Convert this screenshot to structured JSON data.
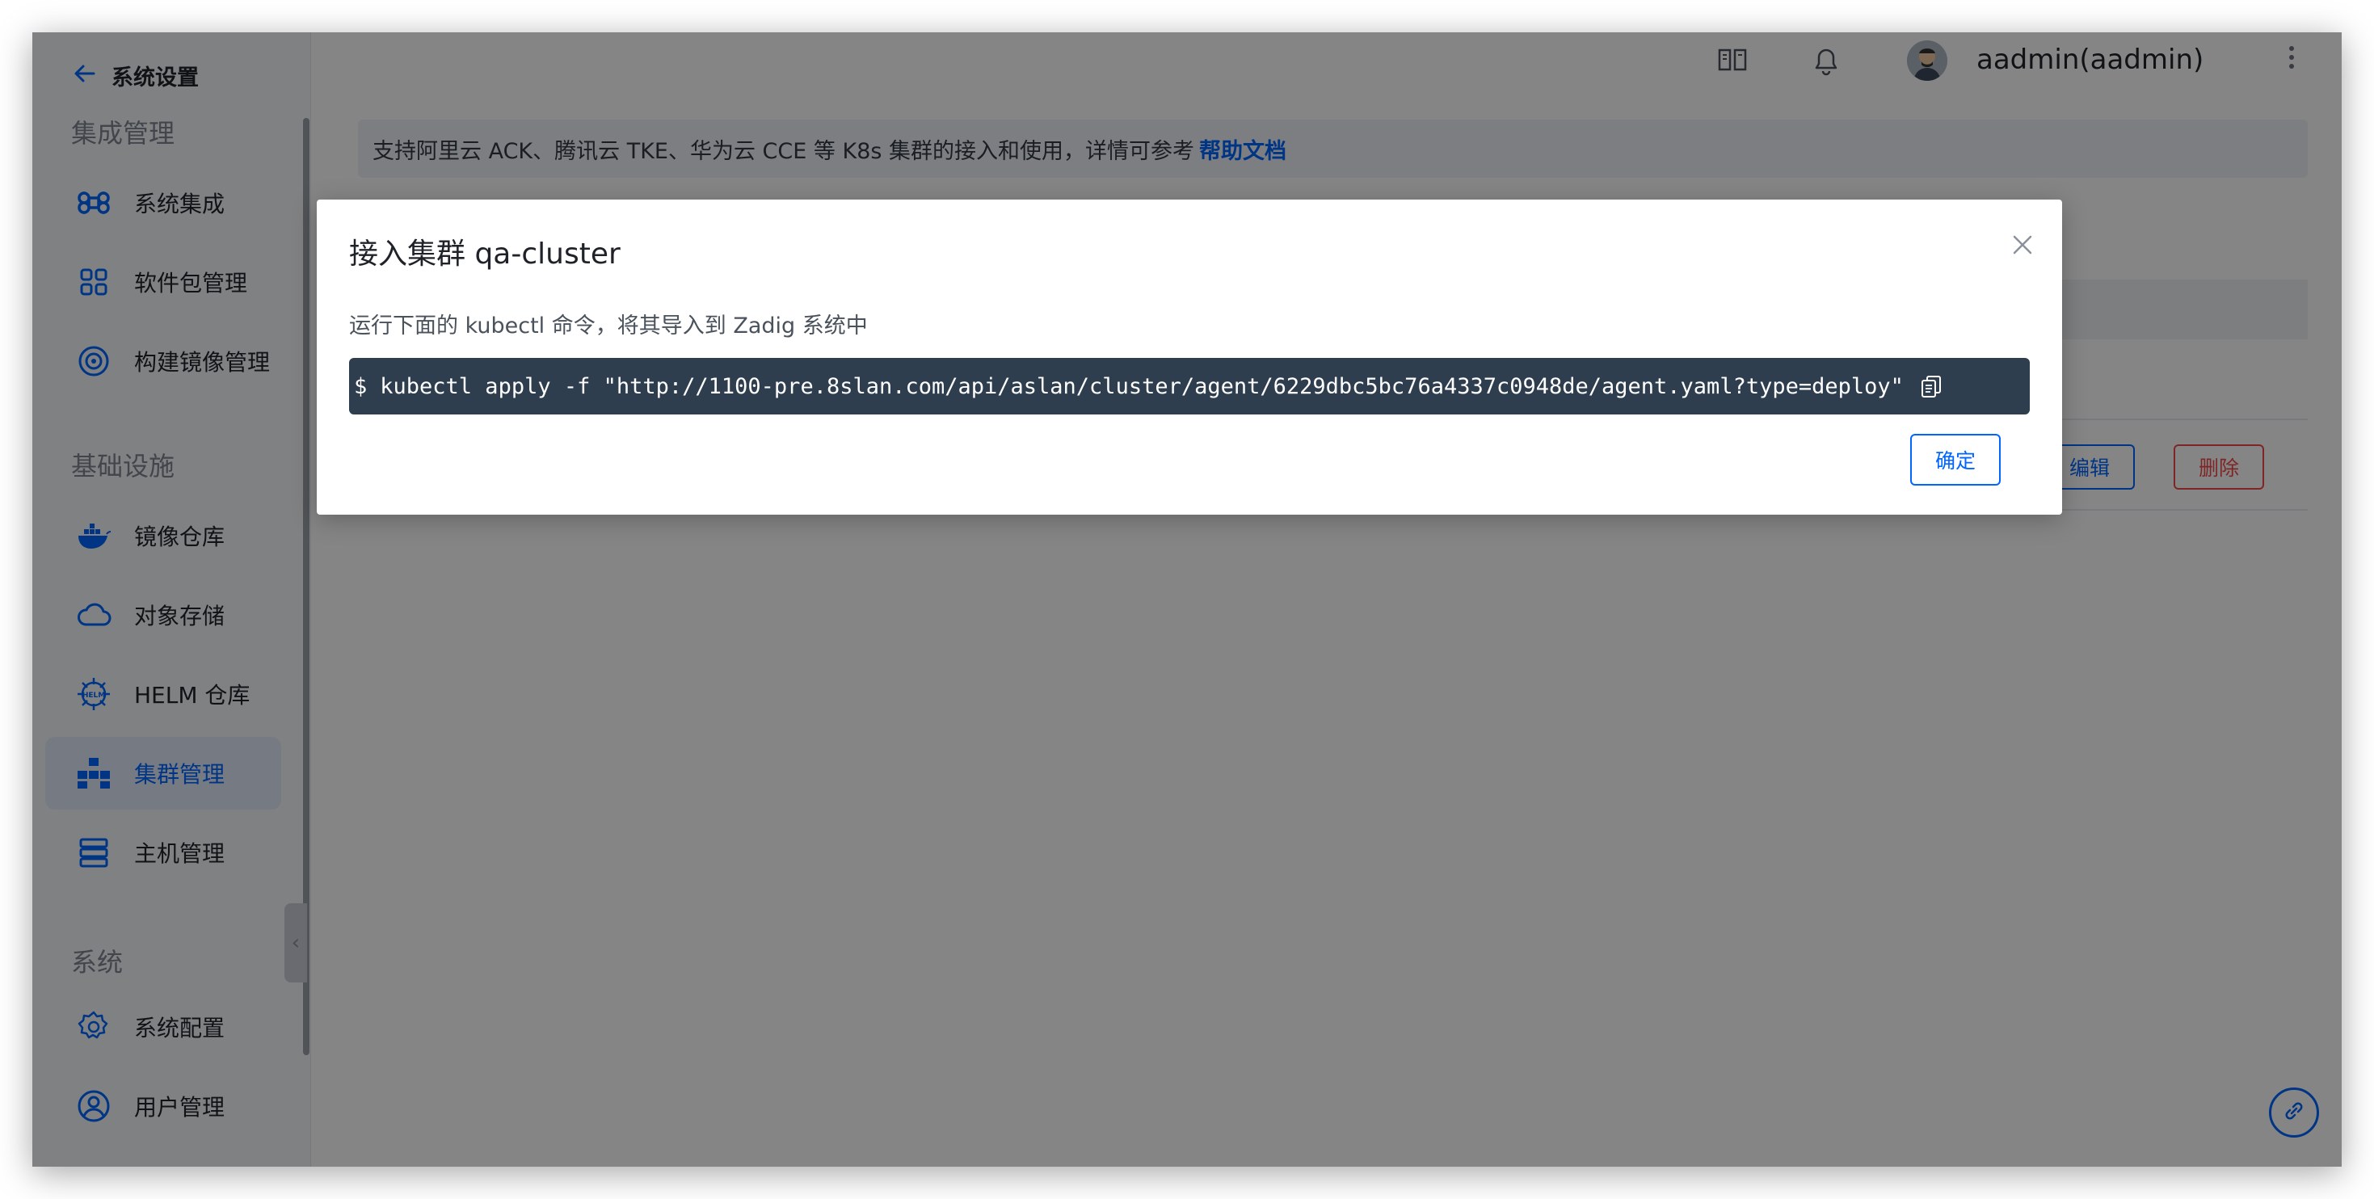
{
  "sidebar": {
    "back_title": "系统设置",
    "groups": [
      {
        "title": "集成管理"
      },
      {
        "title": "基础设施"
      },
      {
        "title": "系统"
      }
    ],
    "items": [
      {
        "label": "系统集成",
        "icon": "command-icon"
      },
      {
        "label": "软件包管理",
        "icon": "apps-icon"
      },
      {
        "label": "构建镜像管理",
        "icon": "disc-icon"
      },
      {
        "label": "镜像仓库",
        "icon": "docker-icon"
      },
      {
        "label": "对象存储",
        "icon": "cloud-icon"
      },
      {
        "label": "HELM 仓库",
        "icon": "helm-icon"
      },
      {
        "label": "集群管理",
        "icon": "cluster-icon"
      },
      {
        "label": "主机管理",
        "icon": "server-icon"
      },
      {
        "label": "系统配置",
        "icon": "settings-icon"
      },
      {
        "label": "用户管理",
        "icon": "user-icon"
      }
    ]
  },
  "topbar": {
    "user": "aadmin(aadmin)"
  },
  "main": {
    "banner_text": "支持阿里云 ACK、腾讯云 TKE、华为云 CCE 等 K8s 集群的接入和使用，详情可参考",
    "banner_link": "帮助文档",
    "edit_label": "编辑",
    "delete_label": "删除"
  },
  "modal": {
    "title": "接入集群 qa-cluster",
    "description": "运行下面的 kubectl 命令，将其导入到 Zadig 系统中",
    "prompt": "$",
    "command": "kubectl apply -f \"http://1100-pre.8slan.com/api/aslan/cluster/agent/6229dbc5bc76a4337c0948de/agent.yaml?type=deploy\"",
    "ok_label": "确定"
  },
  "colors": {
    "accent": "#0066ff",
    "danger": "#f24949",
    "command_bg": "#2f3e4e"
  }
}
